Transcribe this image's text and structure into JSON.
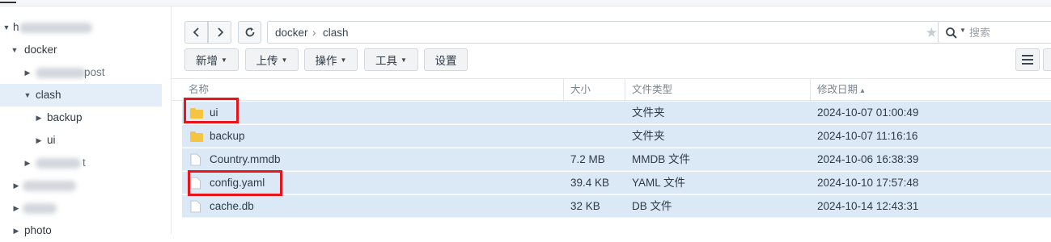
{
  "sidebar": {
    "items": [
      {
        "label": "h",
        "arrow": "▼",
        "blurred": true
      },
      {
        "label": "docker",
        "arrow": "▼"
      },
      {
        "label": "",
        "arrow": "▶",
        "blurred": true,
        "tail": "post"
      },
      {
        "label": "clash",
        "arrow": "▼",
        "selected": true
      },
      {
        "label": "backup",
        "arrow": "▶"
      },
      {
        "label": "ui",
        "arrow": "▶"
      },
      {
        "label": "",
        "arrow": "▶",
        "blurred": true,
        "tail": "t"
      },
      {
        "label": "",
        "arrow": "▶",
        "blurred": true,
        "tail": ""
      },
      {
        "label": "",
        "arrow": "▶",
        "blurred": true,
        "tail": ""
      },
      {
        "label": "photo",
        "arrow": "▶"
      }
    ]
  },
  "toolbar": {
    "back_icon": "chevron-left-icon",
    "forward_icon": "chevron-right-icon",
    "refresh_icon": "refresh-icon",
    "path": [
      "docker",
      "clash"
    ],
    "path_separator": "›",
    "search_placeholder": "搜索",
    "buttons": [
      "新增",
      "上传",
      "操作",
      "工具",
      "设置"
    ]
  },
  "table": {
    "columns": [
      "名称",
      "大小",
      "文件类型",
      "修改日期"
    ],
    "sort_indicator": "▴",
    "rows": [
      {
        "name": "ui",
        "size": "",
        "type": "文件夹",
        "date": "2024-10-07 01:00:49",
        "icon": "folder-icon",
        "highlight": true
      },
      {
        "name": "backup",
        "size": "",
        "type": "文件夹",
        "date": "2024-10-07 11:16:16",
        "icon": "folder-icon"
      },
      {
        "name": "Country.mmdb",
        "size": "7.2 MB",
        "type": "MMDB 文件",
        "date": "2024-10-06 16:38:39",
        "icon": "file-icon"
      },
      {
        "name": "config.yaml",
        "size": "39.4 KB",
        "type": "YAML 文件",
        "date": "2024-10-10 17:57:48",
        "icon": "file-icon",
        "highlight": true
      },
      {
        "name": "cache.db",
        "size": "32 KB",
        "type": "DB 文件",
        "date": "2024-10-14 12:43:31",
        "icon": "file-icon"
      }
    ]
  },
  "colors": {
    "selected_row": "#dbe9f7",
    "highlight_border": "#e8141a",
    "folder": "#f5c542",
    "star": "#c6ccd2"
  }
}
